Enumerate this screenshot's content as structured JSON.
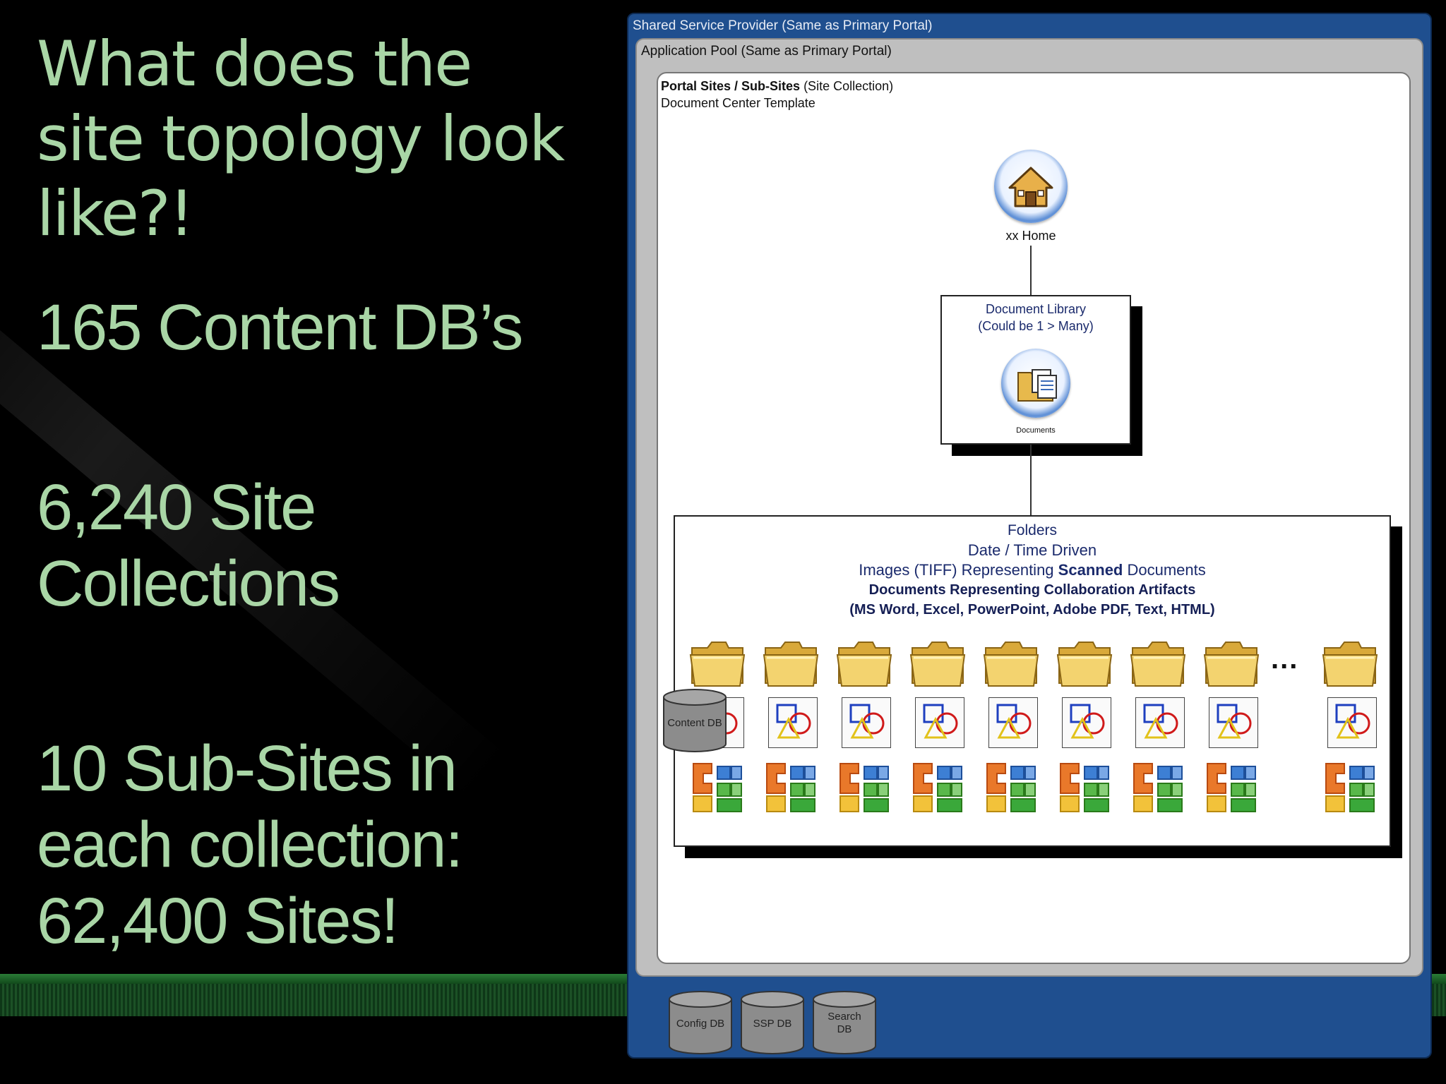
{
  "slide": {
    "title": "What does the site topology look like?!",
    "stat_content_dbs": "165 Content DB’s",
    "stat_site_collections": "6,240 Site Collections",
    "stat_sub_sites": "10 Sub-Sites in each collection: 62,400 Sites!"
  },
  "diagram": {
    "ssp_label": "Shared Service Provider (Same as Primary Portal)",
    "app_pool_label": "Application Pool (Same as Primary Portal)",
    "portal_label_bold": "Portal Sites / Sub-Sites",
    "portal_label_rest": " (Site Collection)",
    "portal_template": "Document Center Template",
    "home": {
      "caption": "xx Home",
      "icon": "house-icon"
    },
    "doc_library": {
      "line1": "Document Library",
      "line2": "(Could be 1 > Many)",
      "icon_caption": "Documents",
      "icon": "documents-icon"
    },
    "folders": {
      "line1": "Folders",
      "line2": "Date / Time Driven",
      "line3_pre": "Images (TIFF) Representing ",
      "line3_bold": "Scanned",
      "line3_post": " Documents",
      "line4": "Documents Representing Collaboration Artifacts",
      "line5": "(MS Word, Excel, PowerPoint, Adobe PDF, Text, HTML)",
      "ellipsis": "...",
      "icons": [
        "folder-icon",
        "shapes-icon",
        "office-icon"
      ]
    },
    "content_db": "Content DB",
    "config_db": "Config DB",
    "ssp_db": "SSP DB",
    "search_db": "Search DB"
  },
  "colors": {
    "text_green": "#a9d6a6",
    "ssp_blue": "#1f4f8f",
    "app_pool_gray": "#bfbfbf",
    "folder_text_navy": "#1a2a6c"
  }
}
